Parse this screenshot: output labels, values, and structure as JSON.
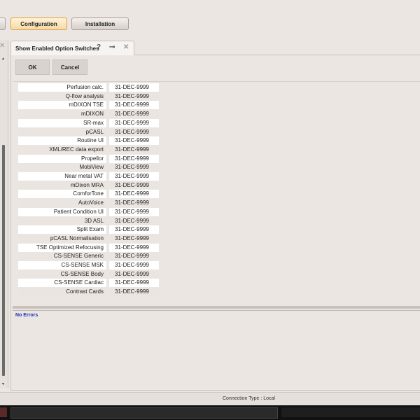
{
  "toolbar": {
    "prev_label": "e",
    "configuration_label": "Configuration",
    "installation_label": "Installation"
  },
  "tab": {
    "title": "Show Enabled Option Switches"
  },
  "actions": {
    "ok_label": "OK",
    "cancel_label": "Cancel"
  },
  "options": [
    {
      "name": "Perfusion calc.",
      "date": "31-DEC-9999"
    },
    {
      "name": "Q-flow analysis",
      "date": "31-DEC-9999"
    },
    {
      "name": "mDIXON TSE",
      "date": "31-DEC-9999"
    },
    {
      "name": "mDIXON",
      "date": "31-DEC-9999"
    },
    {
      "name": "SR-max",
      "date": "31-DEC-9999"
    },
    {
      "name": "pCASL",
      "date": "31-DEC-9999"
    },
    {
      "name": "Routine UI",
      "date": "31-DEC-9999"
    },
    {
      "name": "XML/REC data export",
      "date": "31-DEC-9999"
    },
    {
      "name": "Propellor",
      "date": "31-DEC-9999"
    },
    {
      "name": "MobiView",
      "date": "31-DEC-9999"
    },
    {
      "name": "Near metal VAT",
      "date": "31-DEC-9999"
    },
    {
      "name": "mDixon MRA",
      "date": "31-DEC-9999"
    },
    {
      "name": "ComforTone",
      "date": "31-DEC-9999"
    },
    {
      "name": "AutoVoice",
      "date": "31-DEC-9999"
    },
    {
      "name": "Patient Condition UI",
      "date": "31-DEC-9999"
    },
    {
      "name": "3D ASL",
      "date": "31-DEC-9999"
    },
    {
      "name": "Split Exam",
      "date": "31-DEC-9999"
    },
    {
      "name": "pCASL Normalisation",
      "date": "31-DEC-9999"
    },
    {
      "name": "TSE Optimized Refocusing Control",
      "date": "31-DEC-9999"
    },
    {
      "name": "CS-SENSE Generic",
      "date": "31-DEC-9999"
    },
    {
      "name": "CS-SENSE MSK",
      "date": "31-DEC-9999"
    },
    {
      "name": "CS-SENSE Body",
      "date": "31-DEC-9999"
    },
    {
      "name": "CS-SENSE Cardiac",
      "date": "31-DEC-9999"
    },
    {
      "name": "Contrast Cards",
      "date": "31-DEC-9999"
    }
  ],
  "messages": {
    "status": "No Errors"
  },
  "statusbar": {
    "connection": "Connection Type   :   Local"
  },
  "icons": {
    "help": "question-mark-icon",
    "pin": "pin-icon",
    "close": "close-icon"
  }
}
